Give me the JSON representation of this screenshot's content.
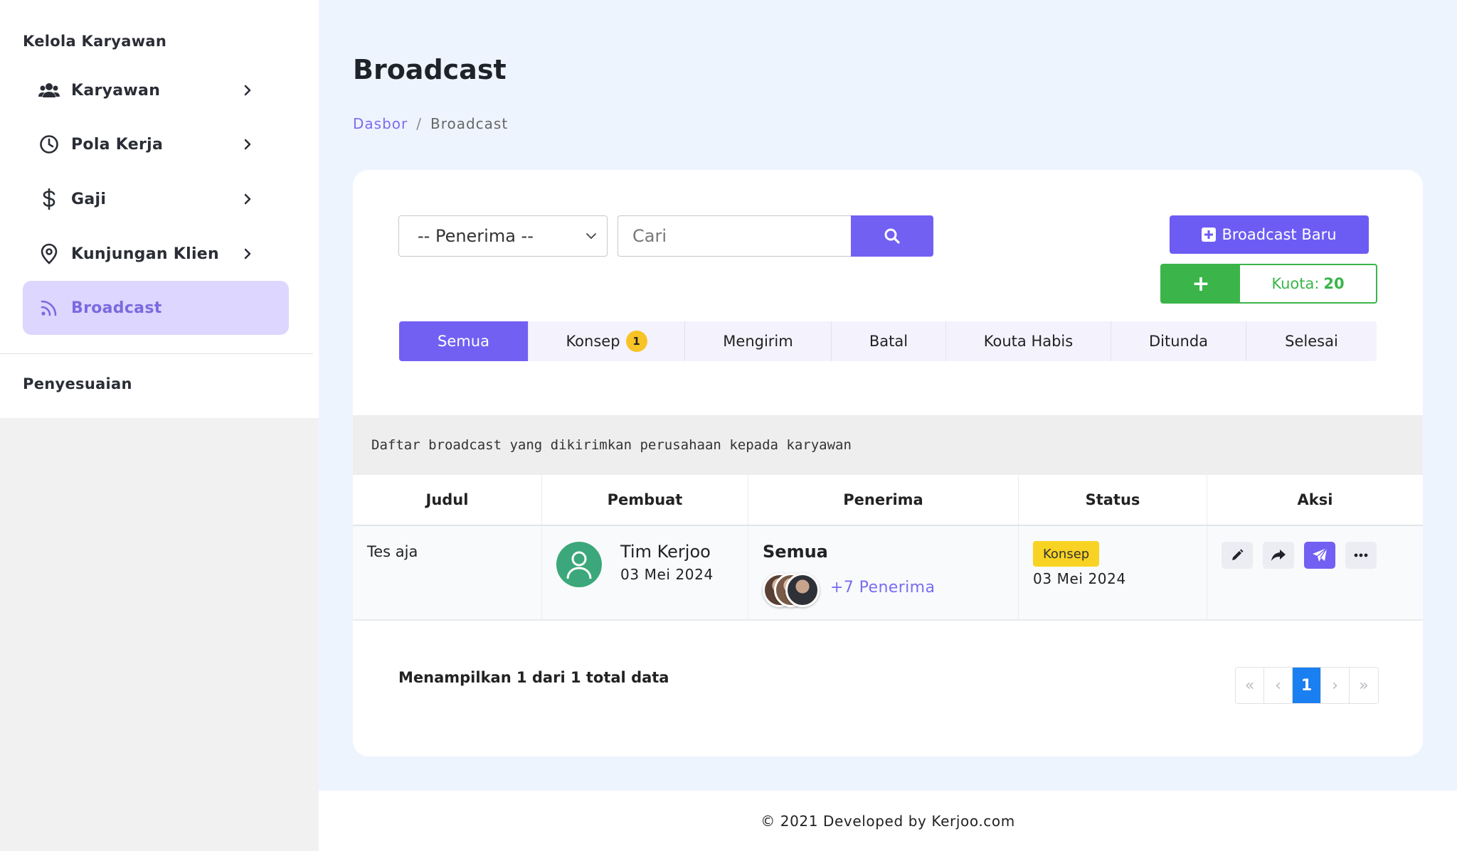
{
  "sidebar": {
    "section_title": "Kelola Karyawan",
    "items": [
      {
        "label": "Karyawan",
        "icon": "users-icon"
      },
      {
        "label": "Pola Kerja",
        "icon": "clock-icon"
      },
      {
        "label": "Gaji",
        "icon": "dollar-icon"
      },
      {
        "label": "Kunjungan Klien",
        "icon": "map-pin-icon"
      },
      {
        "label": "Broadcast",
        "icon": "rss-icon",
        "active": true
      }
    ],
    "section2_title": "Penyesuaian"
  },
  "page": {
    "title": "Broadcast",
    "breadcrumb": {
      "home": "Dasbor",
      "separator": "/",
      "current": "Broadcast"
    }
  },
  "filters": {
    "recipient_select": "-- Penerima --",
    "search_placeholder": "Cari"
  },
  "actions": {
    "new_broadcast_label": "Broadcast Baru",
    "quota_plus": "+",
    "quota_label": "Kuota:",
    "quota_value": "20"
  },
  "tabs": [
    {
      "label": "Semua",
      "active": true
    },
    {
      "label": "Konsep",
      "badge": "1"
    },
    {
      "label": "Mengirim"
    },
    {
      "label": "Batal"
    },
    {
      "label": "Kouta Habis"
    },
    {
      "label": "Ditunda"
    },
    {
      "label": "Selesai"
    }
  ],
  "table": {
    "description": "Daftar broadcast yang dikirimkan perusahaan kepada karyawan",
    "headers": [
      "Judul",
      "Pembuat",
      "Penerima",
      "Status",
      "Aksi"
    ],
    "rows": [
      {
        "title": "Tes aja",
        "creator_name": "Tim Kerjoo",
        "creator_date": "03 Mei 2024",
        "recipients": "Semua",
        "recipients_more": "+7 Penerima",
        "status": "Konsep",
        "status_date": "03 Mei 2024"
      }
    ]
  },
  "pagination": {
    "summary": "Menampilkan 1 dari 1 total data",
    "first": "«",
    "prev": "‹",
    "current": "1",
    "next": "›",
    "last": "»"
  },
  "footer": {
    "text": "© 2021 Developed by Kerjoo.com"
  },
  "colors": {
    "primary": "#7260f3",
    "success": "#3bb54a",
    "status_draft": "#f9d323",
    "page_active": "#1a7ff0",
    "sidebar_active_bg": "#ddd6fe"
  }
}
